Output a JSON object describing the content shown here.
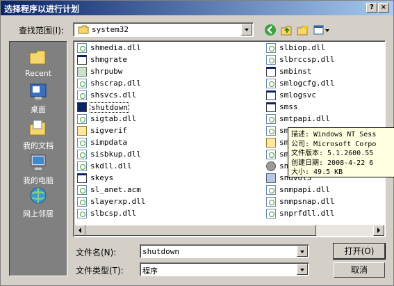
{
  "window": {
    "title": "选择程序以进行计划"
  },
  "lookin": {
    "label": "查找范围(I):",
    "value": "system32"
  },
  "places": [
    "Recent",
    "桌面",
    "我的文档",
    "我的电脑",
    "网上邻居"
  ],
  "files_col1": [
    {
      "name": "shmedia.dll",
      "type": "dll"
    },
    {
      "name": "shmgrate",
      "type": "exe"
    },
    {
      "name": "shrpubw",
      "type": "mod"
    },
    {
      "name": "shscrap.dll",
      "type": "dll"
    },
    {
      "name": "shsvcs.dll",
      "type": "dll"
    },
    {
      "name": "shutdown",
      "type": "exe"
    },
    {
      "name": "sigtab.dll",
      "type": "dll"
    },
    {
      "name": "sigverif",
      "type": "spec"
    },
    {
      "name": "simpdata",
      "type": "dll"
    },
    {
      "name": "sisbkup.dll",
      "type": "dll"
    },
    {
      "name": "skdll.dll",
      "type": "dll"
    },
    {
      "name": "skeys",
      "type": "exe"
    },
    {
      "name": "sl_anet.acm",
      "type": "dll"
    },
    {
      "name": "slayerxp.dll",
      "type": "dll"
    },
    {
      "name": "slbcsp.dll",
      "type": "dll"
    }
  ],
  "files_col2": [
    {
      "name": "slbiop.dll",
      "type": "dll"
    },
    {
      "name": "slbrccsp.dll",
      "type": "dll"
    },
    {
      "name": "smbinst",
      "type": "exe"
    },
    {
      "name": "smlogcfg.dll",
      "type": "dll"
    },
    {
      "name": "smlogsvc",
      "type": "exe"
    },
    {
      "name": "smss",
      "type": "exe"
    },
    {
      "name": "smtpapi.dll",
      "type": "dll"
    },
    {
      "name": "smtpct",
      "type": "dll"
    },
    {
      "name": "smtpct",
      "type": "spec"
    },
    {
      "name": "smtpct",
      "type": "dll"
    },
    {
      "name": "sndrec3",
      "type": "disc"
    },
    {
      "name": "sndvol3",
      "type": "info"
    },
    {
      "name": "snmpapi.dll",
      "type": "dll"
    },
    {
      "name": "snmpsnap.dll",
      "type": "dll"
    },
    {
      "name": "snprfdll.dll",
      "type": "dll"
    }
  ],
  "tooltip": {
    "desc": "描述: Windows NT Sess",
    "company": "公司: Microsoft Corpo",
    "version": "文件版本: 5.1.2600.55",
    "created": "创建日期: 2008-4-22 6",
    "size": "大小: 49.5 KB"
  },
  "filename": {
    "label": "文件名(N):",
    "value": "shutdown"
  },
  "filetype": {
    "label": "文件类型(T):",
    "value": "程序"
  },
  "buttons": {
    "open": "打开(O)",
    "cancel": "取消",
    "help": "?",
    "close": "×"
  },
  "colors": {
    "title_start": "#0a246a",
    "title_end": "#a6caf0",
    "face": "#d4d0c8",
    "tooltip": "#ffffe1"
  }
}
